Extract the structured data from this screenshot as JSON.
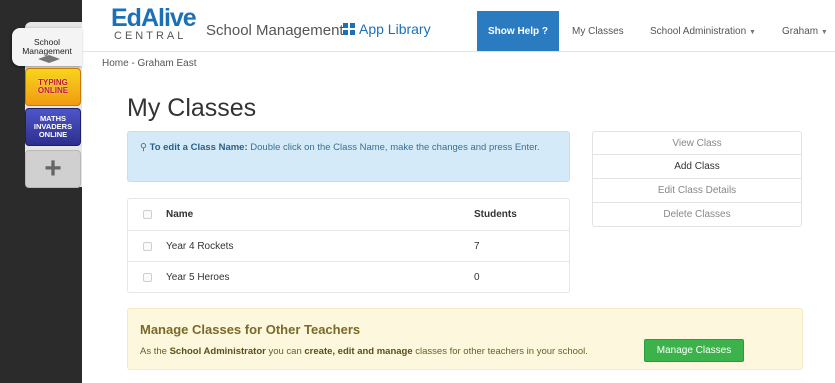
{
  "dock": {
    "school_label": "School Management",
    "typing_label": "TYPING ONLINE",
    "maths_label": "MATHS INVADERS ONLINE",
    "add_label": "+"
  },
  "header": {
    "logo_main": "EdAlive",
    "logo_sub": "CENTRAL",
    "app_name": "School Management",
    "app_library": "App Library",
    "show_help": "Show Help ?",
    "my_classes": "My Classes",
    "school_admin": "School Administration",
    "user": "Graham"
  },
  "breadcrumb": "Home - Graham East",
  "page_title": "My Classes",
  "info": {
    "bold": "To edit a Class Name:",
    "text": " Double click on the Class Name, make the changes and press Enter."
  },
  "actions": [
    "View Class",
    "Add Class",
    "Edit Class Details",
    "Delete Classes"
  ],
  "table": {
    "headers": [
      "Name",
      "Students"
    ],
    "rows": [
      {
        "name": "Year 4 Rockets",
        "students": "7"
      },
      {
        "name": "Year 5 Heroes",
        "students": "0"
      }
    ]
  },
  "manage": {
    "title": "Manage Classes for Other Teachers",
    "text_1": "As the ",
    "text_2": "School Administrator",
    "text_3": " you can ",
    "text_4": "create, edit and manage",
    "text_5": " classes for other teachers in your school.",
    "button": "Manage Classes"
  },
  "colors": {
    "brand_blue": "#1c70b8",
    "help_blue": "#2b7bc0",
    "info_bg": "#d5eaf8",
    "manage_bg": "#fcf7dd",
    "button_green": "#3cb34a"
  }
}
